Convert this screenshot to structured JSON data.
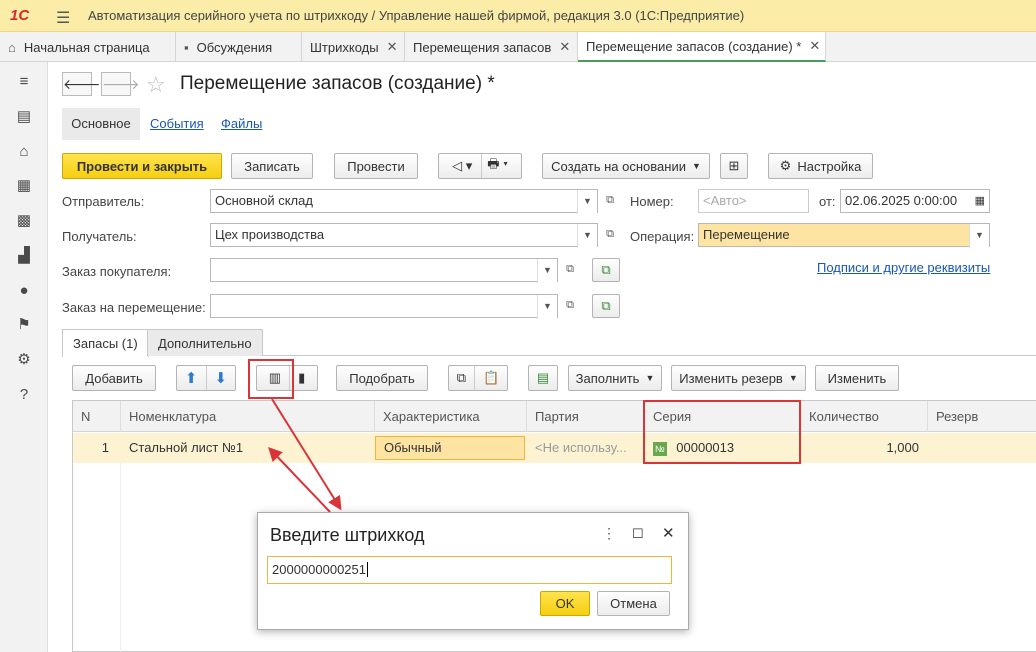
{
  "app": {
    "logo": "1С",
    "title": "Автоматизация серийного учета по штрихкоду / Управление нашей фирмой, редакция 3.0  (1С:Предприятие)"
  },
  "tabs": [
    {
      "label": "Начальная страница"
    },
    {
      "label": "Обсуждения"
    },
    {
      "label": "Штрихкоды"
    },
    {
      "label": "Перемещения запасов"
    },
    {
      "label": "Перемещение запасов (создание) *"
    }
  ],
  "doc": {
    "title": "Перемещение запасов (создание) *",
    "form_tabs": [
      "Основное",
      "События",
      "Файлы"
    ],
    "commands": {
      "post_close": "Провести и закрыть",
      "save": "Записать",
      "post": "Провести",
      "create_based": "Создать на основании",
      "settings": "Настройка"
    },
    "fields": {
      "sender_label": "Отправитель:",
      "sender_value": "Основной склад",
      "receiver_label": "Получатель:",
      "receiver_value": "Цех производства",
      "customer_order_label": "Заказ покупателя:",
      "transfer_order_label": "Заказ на перемещение:",
      "number_label": "Номер:",
      "number_placeholder": "<Авто>",
      "date_label": "от:",
      "date_value": "02.06.2025  0:00:00",
      "operation_label": "Операция:",
      "operation_value": "Перемещение",
      "signatures_link": "Подписи и другие реквизиты"
    },
    "panel_tabs": [
      "Запасы (1)",
      "Дополнительно"
    ],
    "table_commands": {
      "add": "Добавить",
      "pick": "Подобрать",
      "fill": "Заполнить",
      "change_reserve": "Изменить резерв",
      "change": "Изменить"
    },
    "columns": [
      "N",
      "Номенклатура",
      "Характеристика",
      "Партия",
      "Серия",
      "Количество",
      "Резерв"
    ],
    "rows": [
      {
        "n": "1",
        "item": "Стальной лист №1",
        "characteristic": "Обычный",
        "batch": "<Не использу...",
        "series_icon": "№",
        "series": "00000013",
        "qty": "1,000",
        "reserve": ""
      }
    ]
  },
  "dialog": {
    "title": "Введите штрихкод",
    "value": "2000000000251",
    "ok": "OK",
    "cancel": "Отмена"
  },
  "colors": {
    "accent_yellow": "#f5cf10",
    "highlight": "#d9343a",
    "titlebar": "#fbeca8"
  }
}
